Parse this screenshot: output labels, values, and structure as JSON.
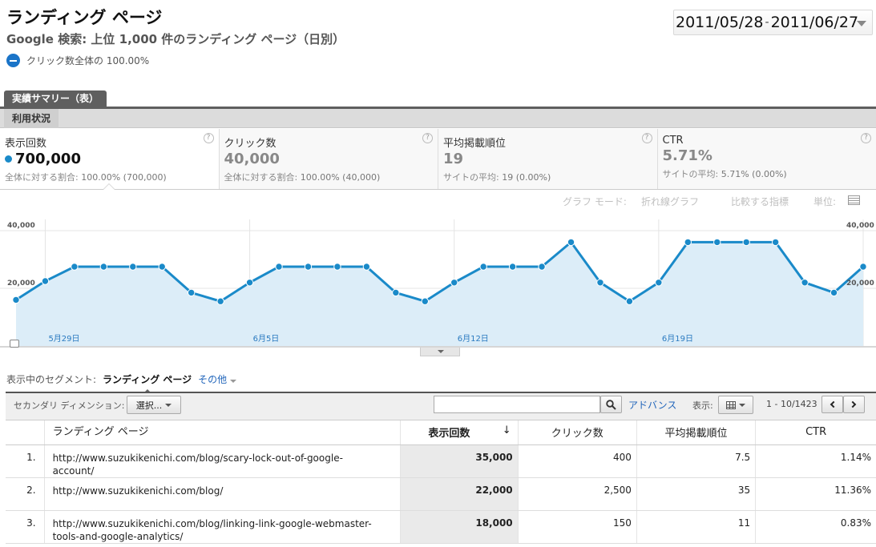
{
  "header": {
    "title": "ランディング ページ",
    "subtitle": "Google 検索: 上位 1,000 件のランディング ページ（日別）",
    "segment": "クリック数全体の 100.00%",
    "date_start": "2011/05/28",
    "date_sep": "-",
    "date_end": "2011/06/27"
  },
  "tabs": {
    "main": "実績サマリー（表）",
    "sub": "利用状況"
  },
  "metrics": [
    {
      "name": "表示回数",
      "value": "700,000",
      "sub_label": "全体に対する割合:",
      "sub_value": "100.00% (700,000)"
    },
    {
      "name": "クリック数",
      "value": "40,000",
      "sub_label": "全体に対する割合:",
      "sub_value": "100.00% (40,000)"
    },
    {
      "name": "平均掲載順位",
      "value": "19",
      "sub_label": "サイトの平均:",
      "sub_value": "19 (0.00%)"
    },
    {
      "name": "CTR",
      "value": "5.71%",
      "sub_label": "サイトの平均:",
      "sub_value": "5.71% (0.00%)"
    }
  ],
  "graph_toolbar": {
    "mode_label": "グラフ モード:",
    "mode_value": "折れ線グラフ",
    "compare": "比較する指標",
    "unit": "単位:",
    "unit_icon": "list-icon"
  },
  "chart_data": {
    "type": "area",
    "y_tick_labels": [
      "40,000",
      "20,000"
    ],
    "ylim": [
      0,
      40000
    ],
    "x_tick_labels": [
      "5月29日",
      "6月5日",
      "6月12日",
      "6月19日"
    ],
    "values": [
      16000,
      22500,
      27500,
      27500,
      27500,
      27500,
      18500,
      15500,
      22000,
      27500,
      27500,
      27500,
      27500,
      18500,
      15500,
      22000,
      27500,
      27500,
      27500,
      36000,
      22000,
      15500,
      22000,
      36000,
      36000,
      36000,
      36000,
      22000,
      18500,
      27500
    ],
    "color": "#1a8ac9",
    "fill": "#dcedf8"
  },
  "segment_row": {
    "label": "表示中のセグメント:",
    "current": "ランディング ページ",
    "more": "その他"
  },
  "table_toolbar": {
    "secondary_label": "セカンダリ ディメンション:",
    "select_label": "選択...",
    "search_value": "",
    "advanced": "アドバンス",
    "display_label": "表示:",
    "pager": "1 - 10/1423"
  },
  "table": {
    "headers": [
      "ランディング ページ",
      "表示回数",
      "クリック数",
      "平均掲載順位",
      "CTR"
    ],
    "sort_arrow": "↓",
    "rows": [
      {
        "idx": "1.",
        "url": "http://www.suzukikenichi.com/blog/scary-lock-out-of-google-account/",
        "impr": "35,000",
        "clicks": "400",
        "pos": "7.5",
        "ctr": "1.14%"
      },
      {
        "idx": "2.",
        "url": "http://www.suzukikenichi.com/blog/",
        "impr": "22,000",
        "clicks": "2,500",
        "pos": "35",
        "ctr": "11.36%"
      },
      {
        "idx": "3.",
        "url": "http://www.suzukikenichi.com/blog/linking-link-google-webmaster-tools-and-google-analytics/",
        "impr": "18,000",
        "clicks": "150",
        "pos": "11",
        "ctr": "0.83%"
      }
    ]
  }
}
